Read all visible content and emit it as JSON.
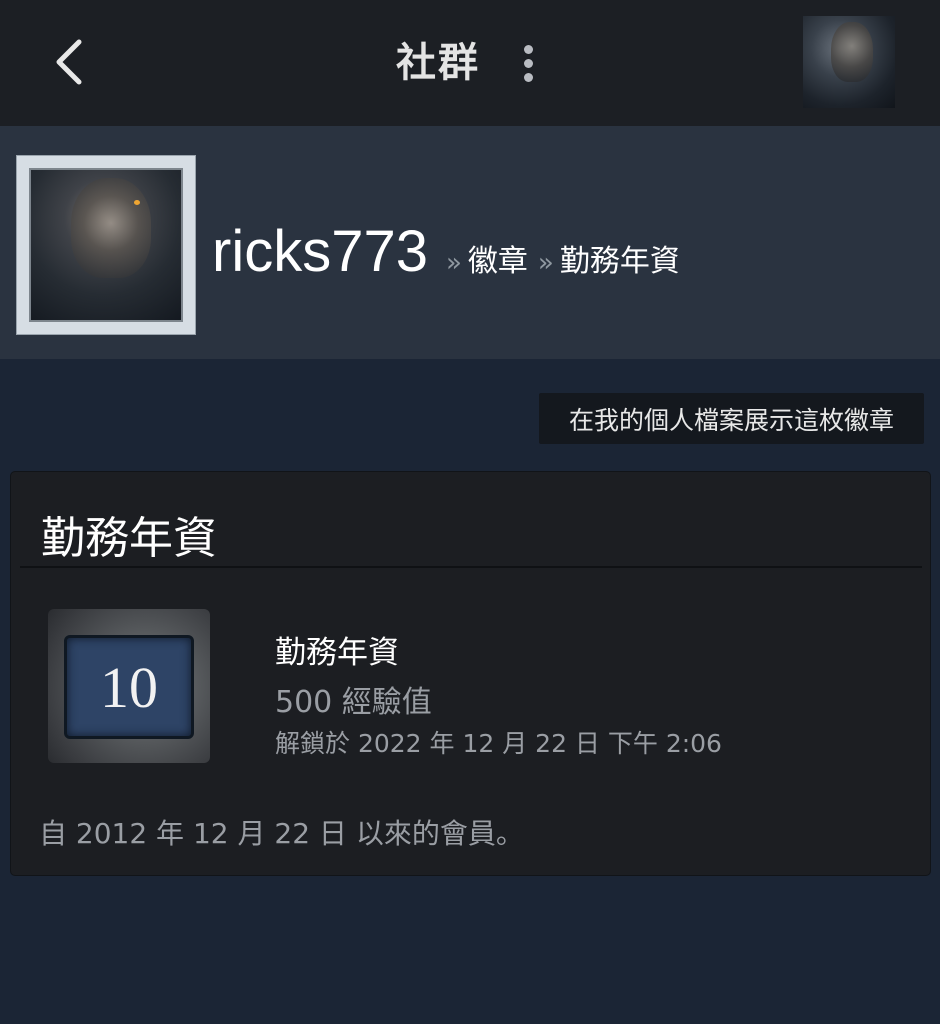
{
  "topbar": {
    "title": "社群",
    "back_icon": "chevron-left-icon",
    "menu_icon": "more-vertical-icon"
  },
  "profile": {
    "username": "ricks773",
    "breadcrumb_sep": "»",
    "breadcrumbs": [
      "徽章",
      "勤務年資"
    ]
  },
  "showcase_button": "在我的個人檔案展示這枚徽章",
  "badge_card": {
    "title": "勤務年資",
    "badge": {
      "level_text": "10",
      "name": "勤務年資",
      "xp": "500 經驗值",
      "unlocked": "解鎖於 2022 年 12 月 22 日 下午 2:06"
    },
    "member_since": "自 2012 年 12 月 22 日 以來的會員。"
  },
  "colors": {
    "topbar_bg": "#1c1f24",
    "header_bg": "#2a3340",
    "page_bg": "#1b2535",
    "card_bg": "#1c1e22",
    "badge_screen": "#2e4466"
  }
}
